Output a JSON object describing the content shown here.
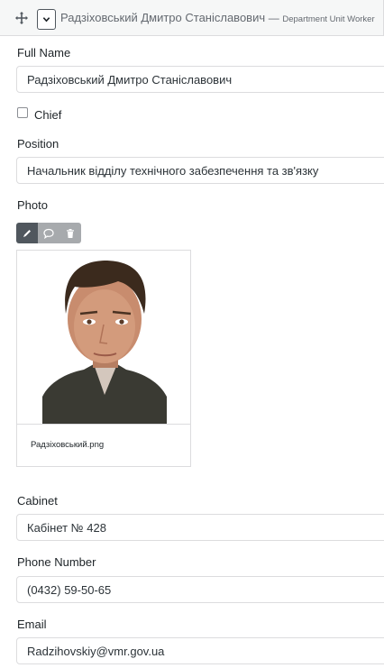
{
  "header": {
    "title": "Радзіховський Дмитро Станіславович",
    "separator": "—",
    "subtitle": "Department Unit Worker"
  },
  "fields": {
    "full_name": {
      "label": "Full Name",
      "value": "Радзіховський Дмитро Станіславович"
    },
    "chief": {
      "label": "Chief",
      "checked": false
    },
    "position": {
      "label": "Position",
      "value": "Начальник відділу технічного забезпечення та зв'язку"
    },
    "photo": {
      "label": "Photo",
      "file_name": "Радзіховський.png"
    },
    "cabinet": {
      "label": "Cabinet",
      "value": "Кабінет № 428"
    },
    "phone": {
      "label": "Phone Number",
      "value": "(0432) 59-50-65"
    },
    "email": {
      "label": "Email",
      "value": "Radzihovskiy@vmr.gov.ua"
    }
  },
  "icons": {
    "move": "move-icon",
    "collapse": "chevron-down-icon",
    "edit": "edit-icon",
    "comment": "comment-icon",
    "delete": "trash-icon"
  },
  "colors": {
    "header_bg": "#f6f7f7",
    "border": "#dcdcde",
    "active_tool": "#50575e",
    "inactive_tool": "#a7aaad"
  }
}
